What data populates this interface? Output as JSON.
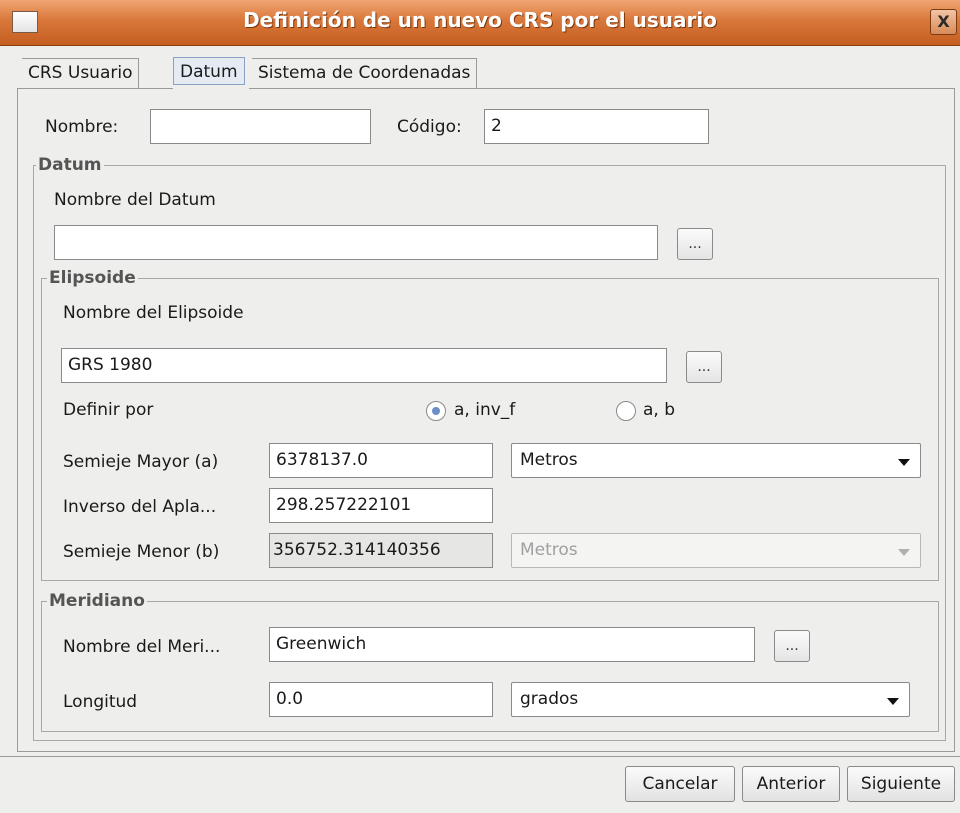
{
  "window": {
    "title": "Definición de un nuevo CRS por el usuario",
    "close_label": "X"
  },
  "tabs": [
    {
      "label": "CRS Usuario",
      "active": false
    },
    {
      "label": "Datum",
      "active": true
    },
    {
      "label": "Sistema de Coordenadas",
      "active": false
    }
  ],
  "form": {
    "nombre_label": "Nombre:",
    "nombre_value": "",
    "codigo_label": "Código:",
    "codigo_value": "2"
  },
  "datum": {
    "group_title": "Datum",
    "name_label": "Nombre del Datum",
    "name_value": "",
    "browse_label": "..."
  },
  "ellipsoid": {
    "group_title": "Elipsoide",
    "name_label": "Nombre del Elipsoide",
    "name_value": "GRS 1980",
    "browse_label": "...",
    "define_by_label": "Definir por",
    "radio_options": [
      "a, inv_f",
      "a, b"
    ],
    "radio_selected": "a, inv_f",
    "semi_major_label": "Semieje Mayor (a)",
    "semi_major_value": "6378137.0",
    "semi_major_unit": "Metros",
    "inverse_flattening_label": "Inverso del Apla...",
    "inverse_flattening_value": "298.257222101",
    "semi_minor_label": "Semieje Menor (b)",
    "semi_minor_value": "356752.314140356",
    "semi_minor_unit": "Metros"
  },
  "meridian": {
    "group_title": "Meridiano",
    "name_label": "Nombre del Meri...",
    "name_value": "Greenwich",
    "browse_label": "...",
    "longitude_label": "Longitud",
    "longitude_value": "0.0",
    "longitude_unit": "grados"
  },
  "buttons": {
    "cancel": "Cancelar",
    "previous": "Anterior",
    "next": "Siguiente"
  }
}
